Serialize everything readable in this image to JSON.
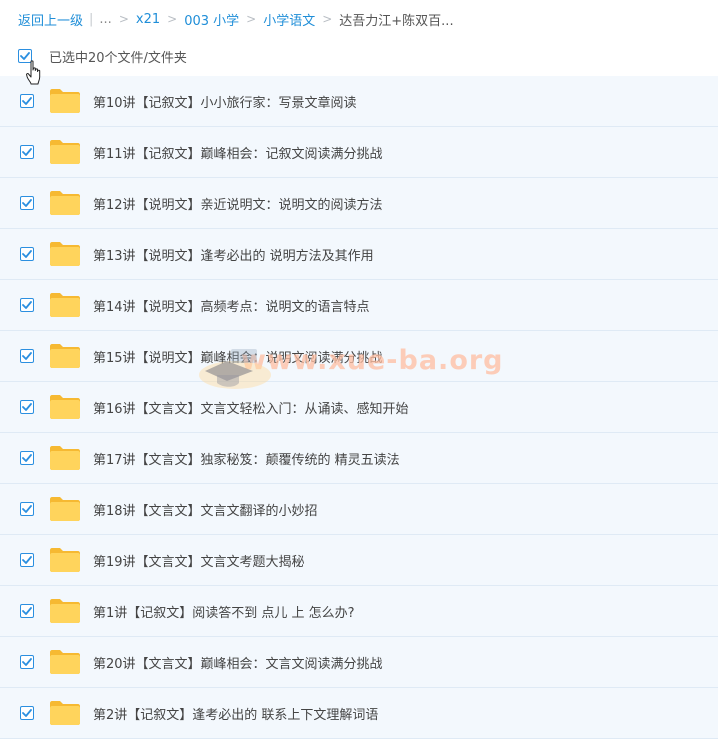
{
  "breadcrumb": {
    "back": "返回上一级",
    "ellipsis": "...",
    "sep": ">",
    "items": [
      "x21",
      "003 小学",
      "小学语文"
    ],
    "current": "达吾力江+陈双百..."
  },
  "selection": {
    "label": "已选中20个文件/文件夹",
    "checked": true
  },
  "files": [
    {
      "name": "第10讲【记叙文】小小旅行家：写景文章阅读",
      "checked": true
    },
    {
      "name": "第11讲【记叙文】巅峰相会：记叙文阅读满分挑战",
      "checked": true
    },
    {
      "name": "第12讲【说明文】亲近说明文：说明文的阅读方法",
      "checked": true
    },
    {
      "name": "第13讲【说明文】逢考必出的 说明方法及其作用",
      "checked": true
    },
    {
      "name": "第14讲【说明文】高频考点：说明文的语言特点",
      "checked": true
    },
    {
      "name": "第15讲【说明文】巅峰相会：说明文阅读满分挑战",
      "checked": true
    },
    {
      "name": "第16讲【文言文】文言文轻松入门：从诵读、感知开始",
      "checked": true
    },
    {
      "name": "第17讲【文言文】独家秘笈：颠覆传统的 精灵五读法",
      "checked": true
    },
    {
      "name": "第18讲【文言文】文言文翻译的小妙招",
      "checked": true
    },
    {
      "name": "第19讲【文言文】文言文考题大揭秘",
      "checked": true
    },
    {
      "name": "第1讲【记叙文】阅读答不到 点儿 上 怎么办?",
      "checked": true
    },
    {
      "name": "第20讲【文言文】巅峰相会：文言文阅读满分挑战",
      "checked": true
    },
    {
      "name": "第2讲【记叙文】逢考必出的 联系上下文理解词语",
      "checked": true
    }
  ],
  "watermark": {
    "text": "www.xue-ba.org"
  },
  "colors": {
    "link": "#1f8ed8",
    "row_bg": "#f3f8fd",
    "checkbox": "#2b8fe0",
    "folder": "#ffc94a"
  }
}
